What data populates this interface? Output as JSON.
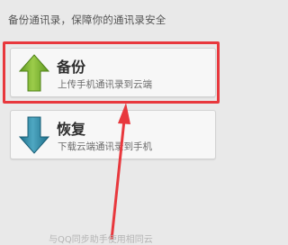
{
  "header": {
    "text": "备份通讯录，保障你的通讯录安全"
  },
  "actions": [
    {
      "title": "备份",
      "subtitle": "上传手机通讯录到云端",
      "icon": "up-arrow-icon",
      "color": "#7cb132"
    },
    {
      "title": "恢复",
      "subtitle": "下载云端通讯录到手机",
      "icon": "down-arrow-icon",
      "color": "#2f8aa6"
    }
  ],
  "footer": {
    "text": "与QQ同步助手使用相同云"
  },
  "annotation": {
    "color": "#e8383d"
  }
}
